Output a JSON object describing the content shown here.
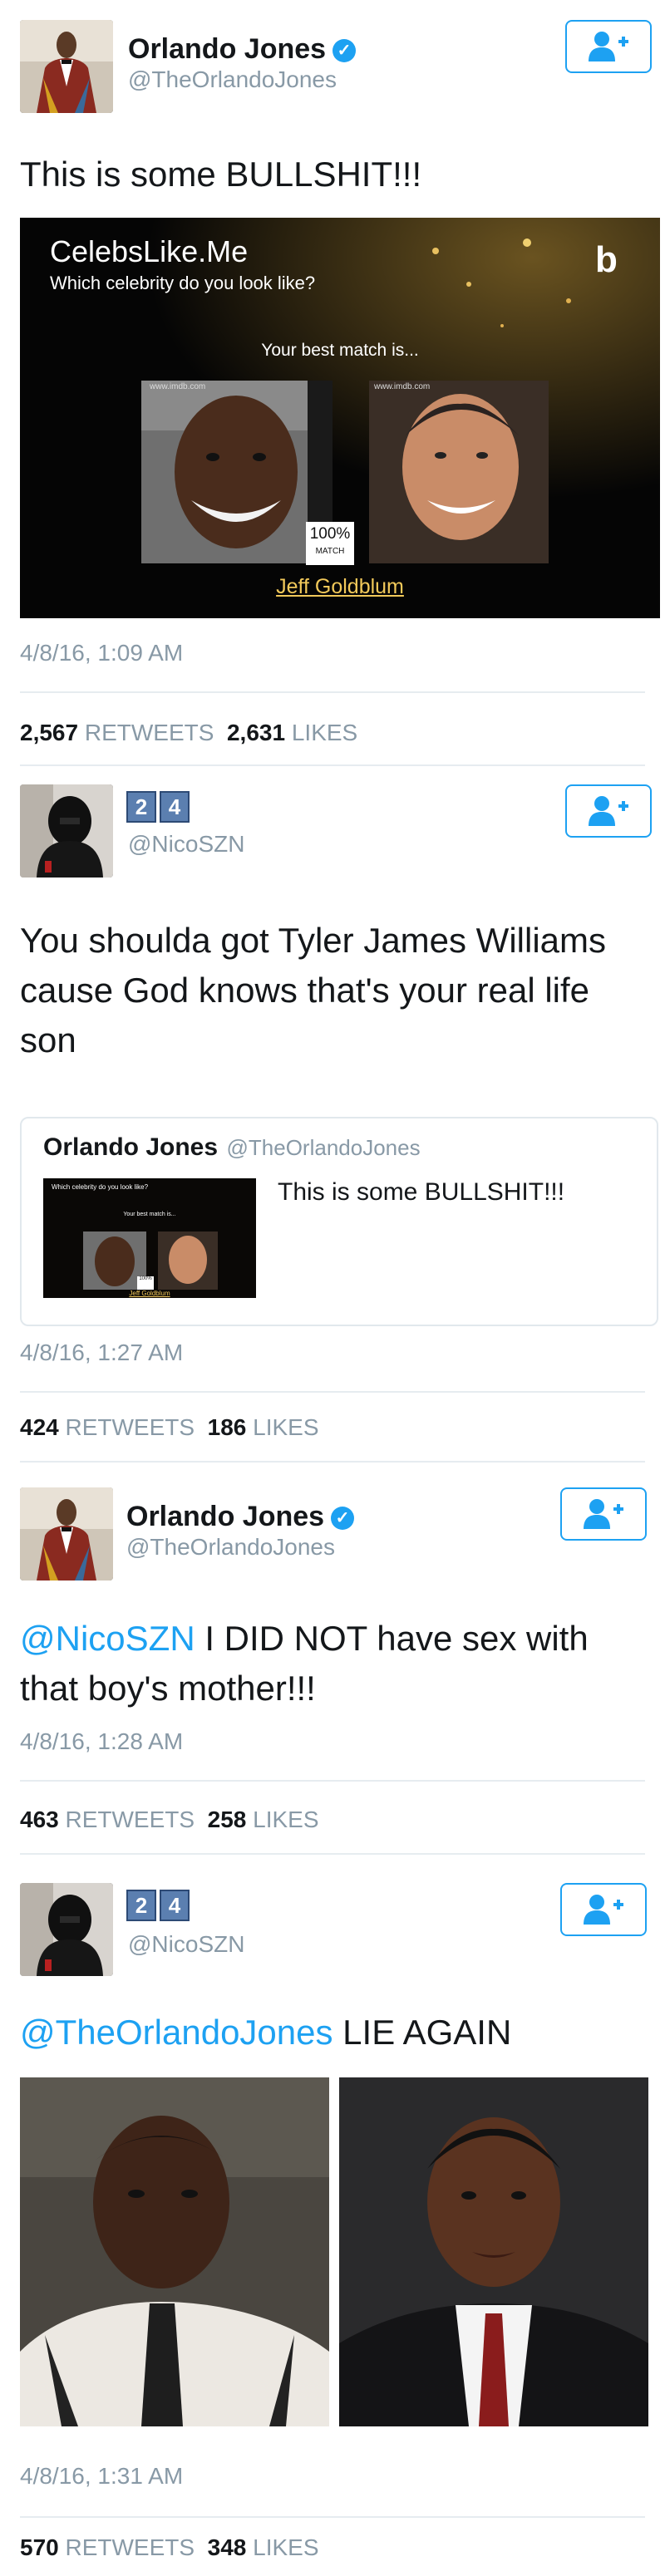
{
  "tweets": [
    {
      "name": "Orlando Jones",
      "handle": "@TheOrlandoJones",
      "text": "This is some BULLSHIT!!!",
      "media": {
        "brand": "CelebsLike.Me",
        "tagline": "Which celebrity do you look like?",
        "best_match": "Your best match is...",
        "source_left": "www.imdb.com",
        "source_right": "www.imdb.com",
        "match_pct": "100%",
        "match_word": "MATCH",
        "celebrity": "Jeff Goldblum",
        "logo": "b"
      },
      "timestamp": "4/8/16, 1:09 AM",
      "retweets": "2,567",
      "retweets_label": "RETWEETS",
      "likes": "2,631",
      "likes_label": "LIKES"
    },
    {
      "badges": [
        "2",
        "4"
      ],
      "handle": "@NicoSZN",
      "text": "You shoulda got Tyler James Williams cause God knows that's your real life son",
      "quote": {
        "name": "Orlando Jones",
        "handle": "@TheOrlandoJones",
        "text": "This is some BULLSHIT!!!",
        "thumb_tagline": "Which celebrity do you look like?",
        "thumb_best": "Your best match is...",
        "thumb_pct": "100%",
        "thumb_celebrity": "Jeff Goldblum"
      },
      "timestamp": "4/8/16, 1:27 AM",
      "retweets": "424",
      "retweets_label": "RETWEETS",
      "likes": "186",
      "likes_label": "LIKES"
    },
    {
      "name": "Orlando Jones",
      "handle": "@TheOrlandoJones",
      "mention": "@NicoSZN",
      "text": " I DID NOT have sex with that boy's mother!!!",
      "timestamp": "4/8/16, 1:28 AM",
      "retweets": "463",
      "retweets_label": "RETWEETS",
      "likes": "258",
      "likes_label": "LIKES"
    },
    {
      "badges": [
        "2",
        "4"
      ],
      "handle": "@NicoSZN",
      "mention": "@TheOrlandoJones",
      "text": " LIE AGAIN",
      "timestamp": "4/8/16, 1:31 AM",
      "retweets": "570",
      "retweets_label": "RETWEETS",
      "likes": "348",
      "likes_label": "LIKES"
    }
  ],
  "colors": {
    "accent": "#1da1f2",
    "muted": "#8899a6",
    "divider": "#e6ecf0",
    "text": "#14171a"
  },
  "icons": {
    "verified": "verified-badge-icon",
    "follow": "follow-user-icon"
  }
}
